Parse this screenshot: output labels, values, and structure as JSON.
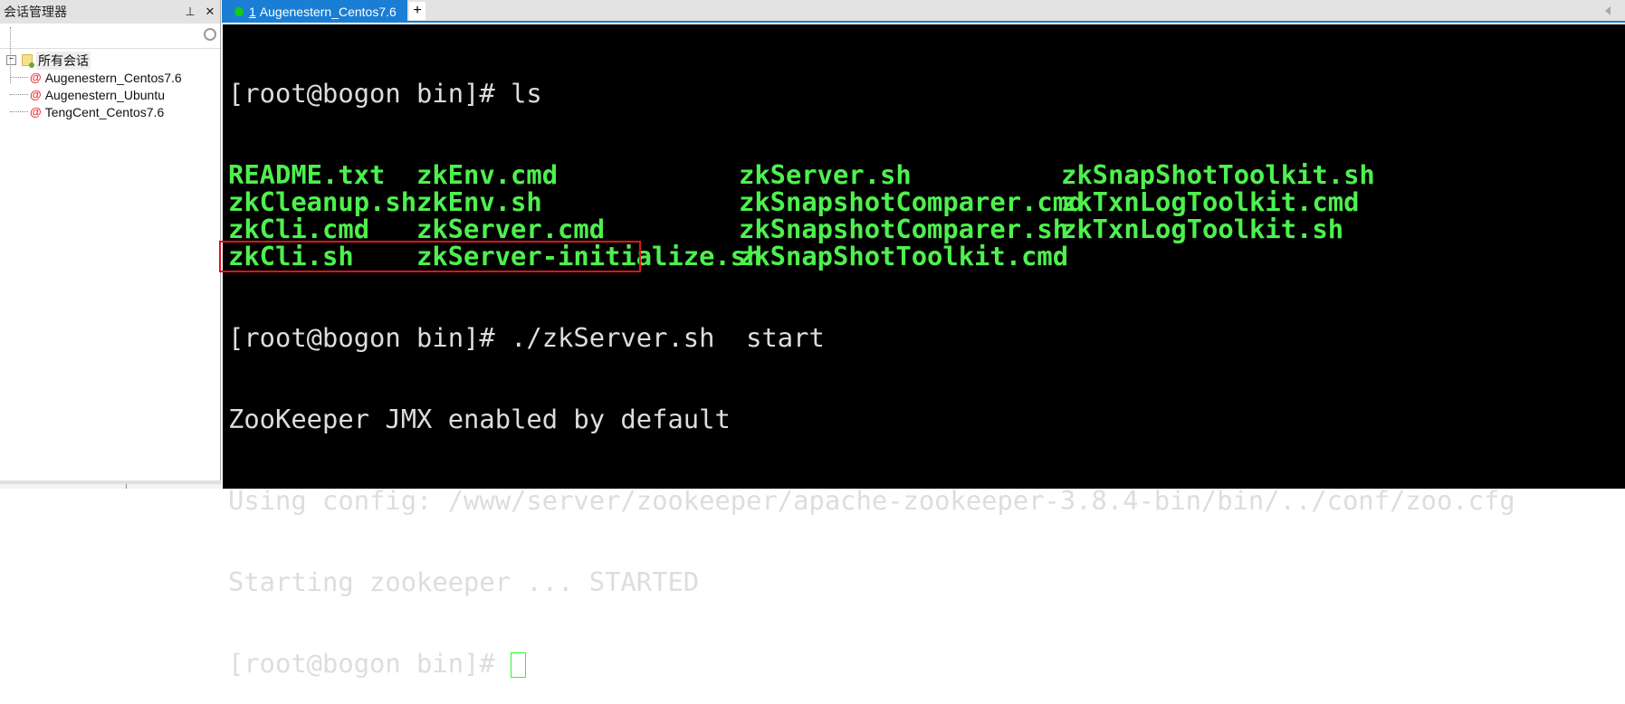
{
  "sidebar": {
    "title": "会话管理器",
    "pin_icon": "pin-icon",
    "close_label": "✕",
    "search_placeholder": "",
    "root": "所有会话",
    "sessions": [
      "Augenestern_Centos7.6",
      "Augenestern_Ubuntu",
      "TengCent_Centos7.6"
    ]
  },
  "tabs": [
    {
      "index": "1",
      "label": "Augenestern_Centos7.6",
      "status_color": "#1c1"
    }
  ],
  "terminal": {
    "prompt1": "[root@bogon bin]# ls",
    "ls_rows": [
      [
        "README.txt",
        "zkEnv.cmd",
        "zkServer.sh",
        "zkSnapShotToolkit.sh"
      ],
      [
        "zkCleanup.sh",
        "zkEnv.sh",
        "zkSnapshotComparer.cmd",
        "zkTxnLogToolkit.cmd"
      ],
      [
        "zkCli.cmd",
        "zkServer.cmd",
        "zkSnapshotComparer.sh",
        "zkTxnLogToolkit.sh"
      ],
      [
        "zkCli.sh",
        "zkServer-initialize.sh",
        "zkSnapShotToolkit.cmd",
        ""
      ]
    ],
    "prompt2": "[root@bogon bin]# ./zkServer.sh  start",
    "out1": "ZooKeeper JMX enabled by default",
    "out2": "Using config: /www/server/zookeeper/apache-zookeeper-3.8.4-bin/bin/../conf/zoo.cfg",
    "out3": "Starting zookeeper ... STARTED",
    "prompt3": "[root@bogon bin]# "
  }
}
